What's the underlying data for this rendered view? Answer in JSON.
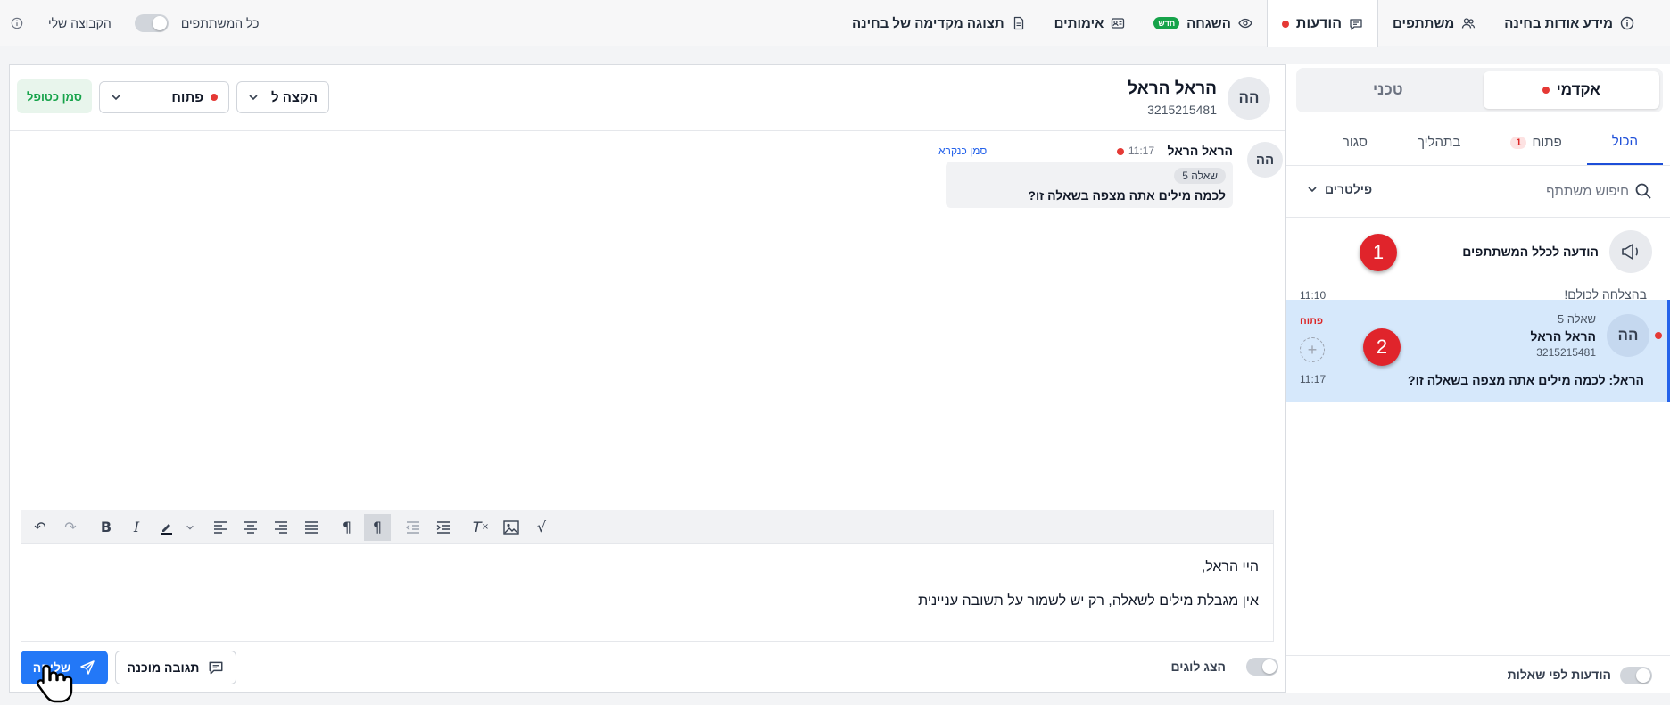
{
  "topnav": {
    "items": [
      {
        "label": "מידע אודות בחינה",
        "icon": "info-icon"
      },
      {
        "label": "משתתפים",
        "icon": "users-icon"
      },
      {
        "label": "הודעות",
        "icon": "chat-icon"
      },
      {
        "label": "השגחה",
        "icon": "eye-icon",
        "badge": "חדש"
      },
      {
        "label": "אימותים",
        "icon": "id-card-icon"
      },
      {
        "label": "תצוגה מקדימה של בחינה",
        "icon": "document-icon"
      }
    ],
    "all_participants_label": "כל המשתתפים",
    "my_group_label": "הקבוצה שלי"
  },
  "sidebar": {
    "segments": [
      "אקדמי",
      "טכני"
    ],
    "subtabs": [
      "הכול",
      "פתוח",
      "בתהליך",
      "סגור"
    ],
    "open_count": "1",
    "search_placeholder": "חיפוש משתתף",
    "filters_label": "פילטרים",
    "broadcast": {
      "title": "הודעה לכלל המשתתפים",
      "preview": "בהצלחה לכולם!",
      "time": "11:10"
    },
    "conversation": {
      "avatar": "הה",
      "question": "שאלה 5",
      "name": "הראל הראל",
      "id": "3215215481",
      "preview": "הראל: לכמה מילים אתה מצפה בשאלה זו?",
      "status": "פתוח",
      "time": "11:17"
    },
    "footer_toggle_label": "הודעות לפי שאלות"
  },
  "main": {
    "header": {
      "avatar": "הה",
      "name": "הראל הראל",
      "id": "3215215481",
      "assign_label": "הקצה ל",
      "status_label": "פתוח",
      "duplicate_label": "סמן כטופל"
    },
    "message": {
      "avatar": "הה",
      "sender": "הראל הראל",
      "time": "11:17",
      "mark_read": "סמן כנקרא",
      "question_badge": "שאלה 5",
      "text": "לכמה מילים אתה מצפה בשאלה זו?"
    },
    "editor": {
      "line1": "היי הראל,",
      "line2": "אין מגבלת מילים לשאלה, רק יש לשמור על תשובה עניינית"
    },
    "show_logs_label": "הצג לוגים",
    "ready_answer_label": "תגובה מוכנה",
    "send_label": "שליחה"
  },
  "annotations": [
    "1",
    "2"
  ],
  "colors": {
    "accent": "#2378f7",
    "red": "#e53935",
    "selected_bg": "#d6e8fb",
    "green": "#16a34a"
  }
}
